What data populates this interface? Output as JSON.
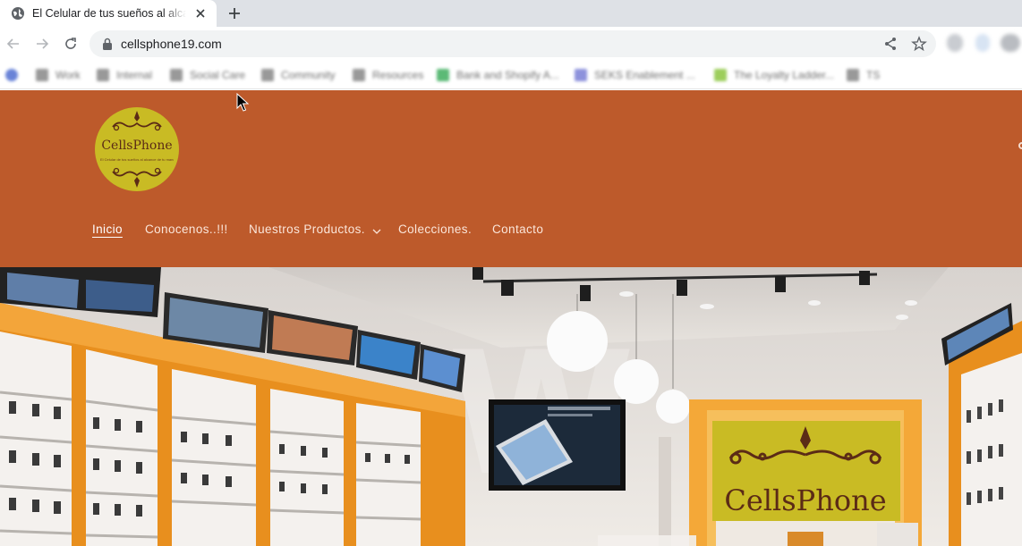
{
  "browser": {
    "tab_title": "El Celular de tus sueños al alcance de tu mano",
    "url": "cellsphone19.com",
    "bookmarks": [
      "Work",
      "Internal",
      "Social Care",
      "Community",
      "Resources",
      "Bank and Shopify A...",
      "SEKS Enablement ...",
      "The Loyalty Ladder...",
      "TS"
    ]
  },
  "site": {
    "logo_name": "CellsPhone",
    "logo_tagline": "El Celular de tus sueños al alcance de tu mano",
    "nav": [
      {
        "label": "Inicio",
        "active": true
      },
      {
        "label": "Conocenos..!!!",
        "active": false
      },
      {
        "label": "Nuestros Productos.",
        "active": false,
        "has_dropdown": true
      },
      {
        "label": "Colecciones.",
        "active": false
      },
      {
        "label": "Contacto",
        "active": false
      }
    ],
    "hero_sign": "CellsPhone"
  },
  "colors": {
    "header_bg": "#bd5a2b",
    "logo_bg": "#c9bb24",
    "nav_text": "#fbe6da"
  }
}
